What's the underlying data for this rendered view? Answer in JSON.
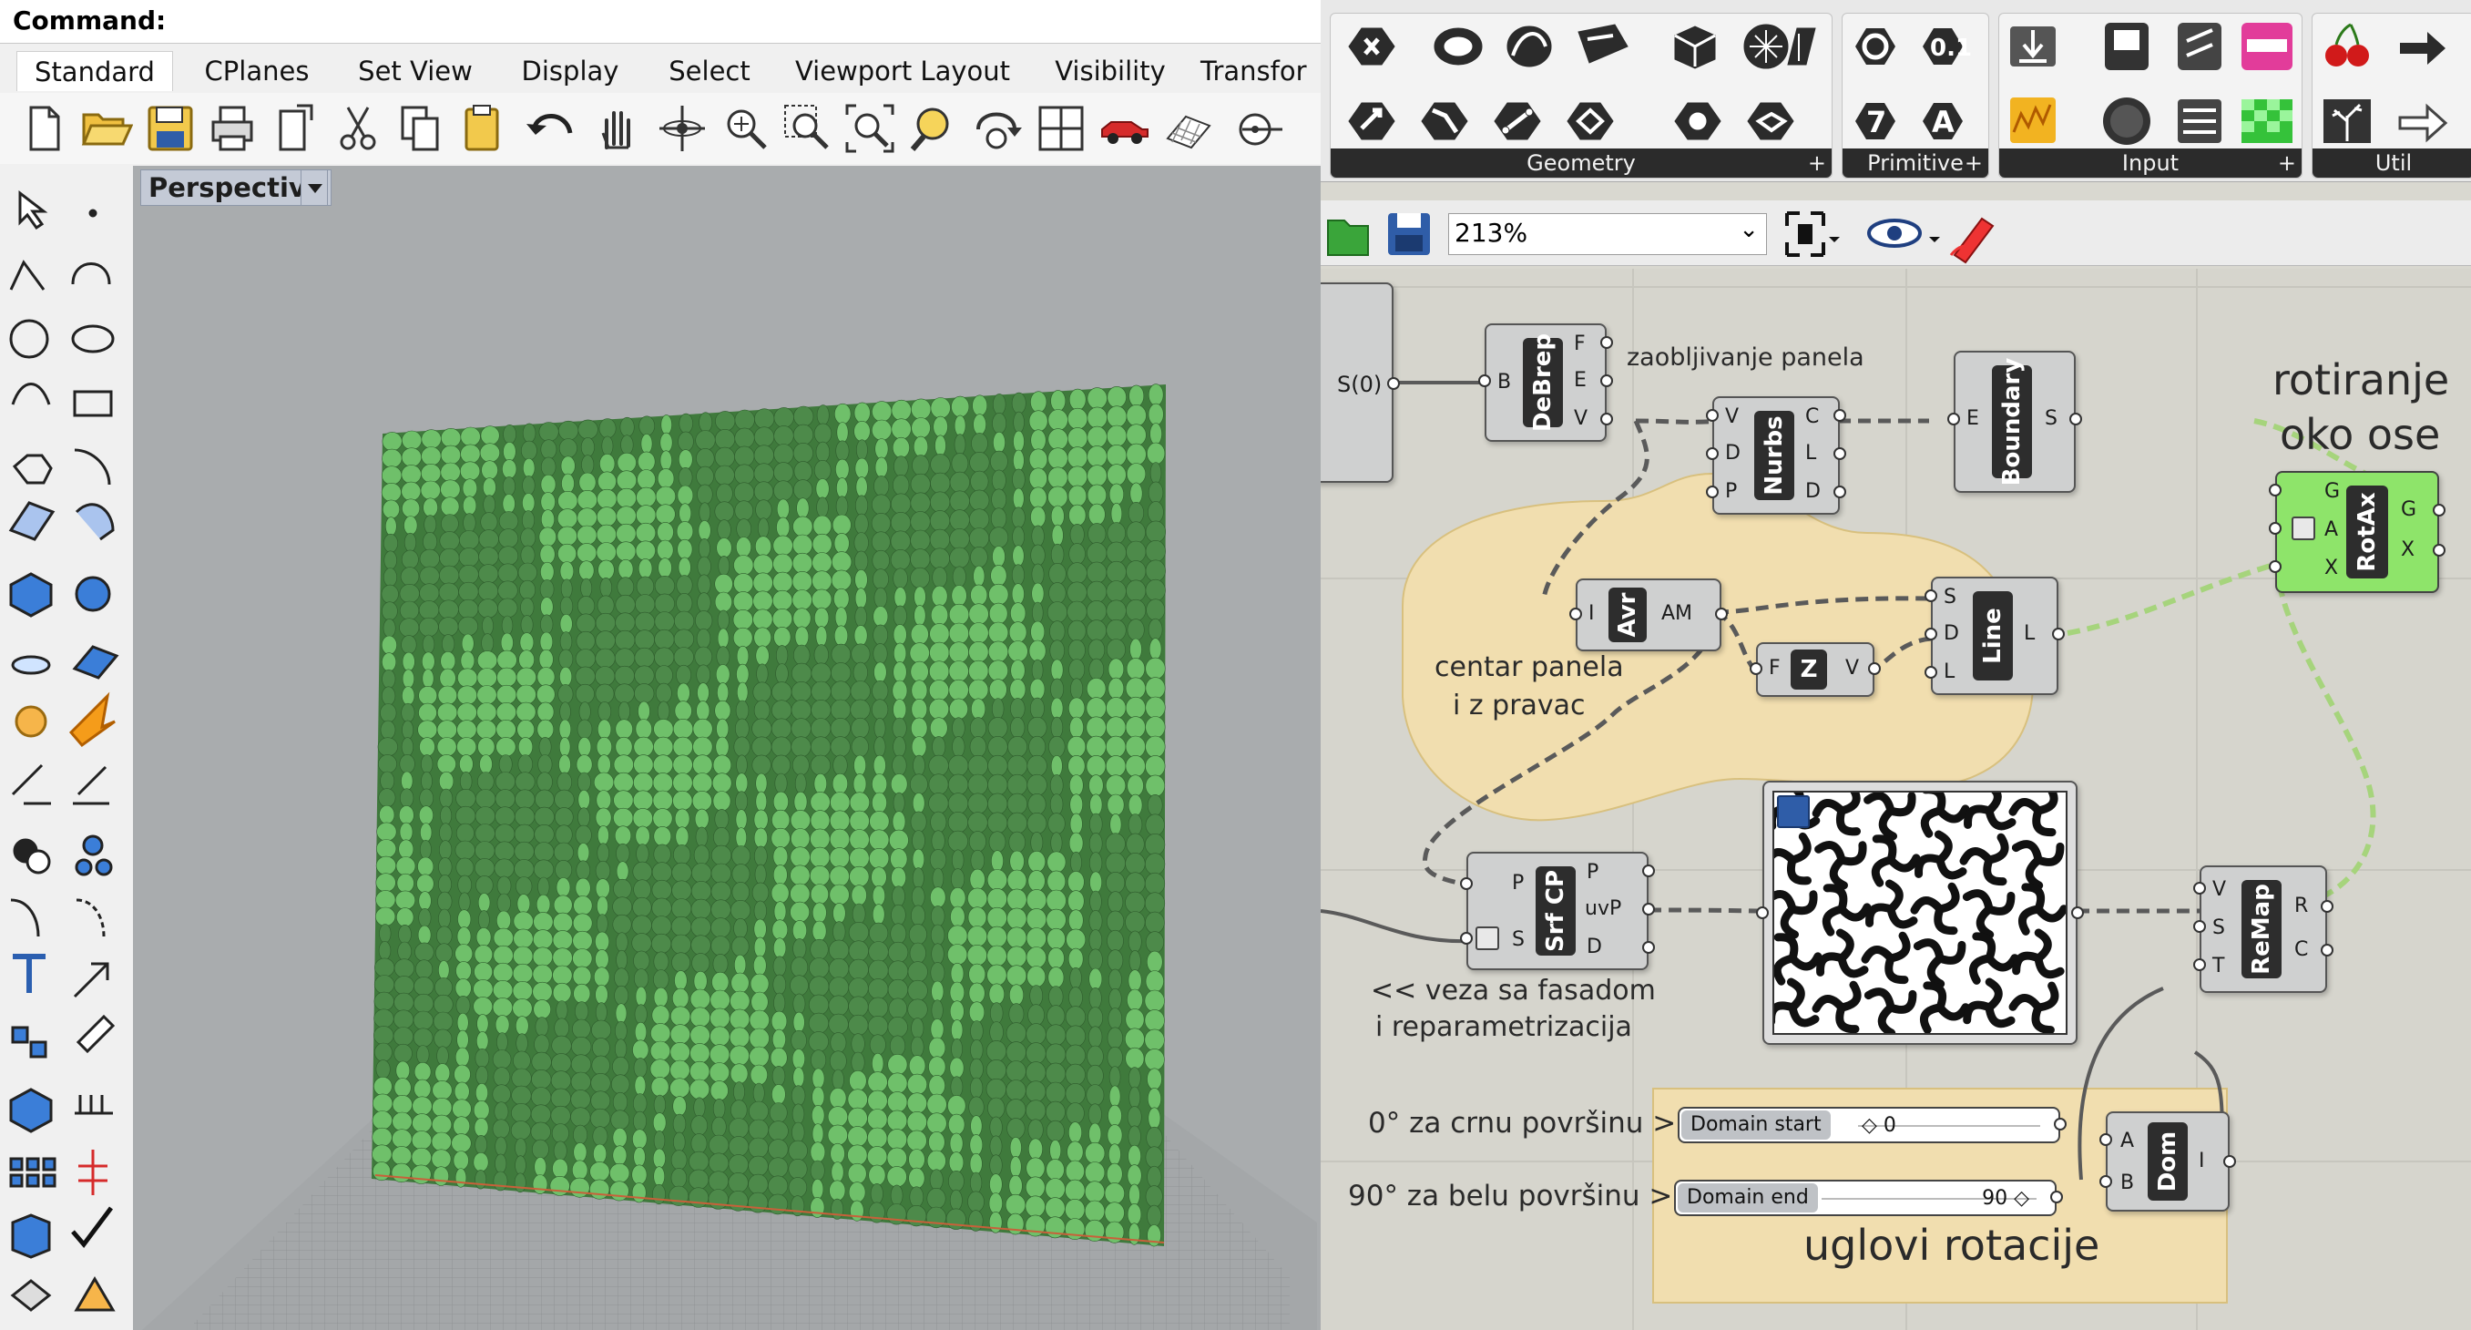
{
  "rhino": {
    "command_label": "Command:",
    "tabs": [
      "Standard",
      "CPlanes",
      "Set View",
      "Display",
      "Select",
      "Viewport Layout",
      "Visibility",
      "Transfor"
    ],
    "active_tab": "Standard",
    "toolbar_icons": [
      "new-icon",
      "open-icon",
      "save-icon",
      "print-icon",
      "import-icon",
      "cut-icon",
      "copy-icon",
      "paste-icon",
      "undo-icon",
      "pan-icon",
      "rotate-view-icon",
      "zoom-icon",
      "zoom-window-icon",
      "zoom-extents-icon",
      "zoom-selected-icon",
      "rotate-icon",
      "four-viewports-icon",
      "car-icon",
      "grid-icon",
      "point-icon"
    ],
    "left_tools": [
      "select-arrow-icon",
      "point-icon",
      "polyline-icon",
      "arc-icon",
      "circle-icon",
      "ellipse-icon",
      "curve-icon",
      "rectangle-icon",
      "polygon-icon",
      "fillet-icon",
      "surface-icon",
      "extrude-icon",
      "box-icon",
      "sphere-icon",
      "cylinder-icon",
      "mesh-icon",
      "gear-icon",
      "explode-icon",
      "trim-icon",
      "split-icon",
      "boolean-icon",
      "join-icon",
      "offset-icon",
      "blend-icon",
      "text-icon",
      "scale-icon",
      "array-icon",
      "edit-icon",
      "solid-box-icon",
      "dimension-icon",
      "grid-array-icon",
      "align-icon",
      "material-icon",
      "check-icon",
      "render-icon",
      "light-icon"
    ],
    "viewport_title": "Perspective",
    "colors": {
      "panel_light": "#6fc06a",
      "panel_dark": "#4d8a4a",
      "ground": "#8f9294"
    }
  },
  "grasshopper": {
    "ribbon_groups": [
      {
        "label": "Geometry",
        "icons": [
          "hexagon-icon",
          "ellipse-icon",
          "spiral-icon",
          "surface-icon",
          "cube-icon",
          "mesh-icon",
          "brep-icon",
          "vector-icon",
          "curve-icon",
          "line-icon",
          "plane-icon",
          "sphere-icon",
          "twisted-icon"
        ]
      },
      {
        "label": "Primitive",
        "icons": [
          "circle-icon",
          "binary-icon",
          "number-seven-icon",
          "letter-a-icon"
        ]
      },
      {
        "label": "Input",
        "icons": [
          "download-icon",
          "toggle-icon",
          "mobile-icon",
          "gradient-icon",
          "graph-mapper-icon",
          "button-icon",
          "value-list-icon",
          "image-icon"
        ]
      },
      {
        "label": "Util",
        "icons": [
          "cherry-icon",
          "arrow-right-icon",
          "tree-icon",
          "arrow-outline-icon"
        ]
      }
    ],
    "zoom": "213%",
    "toolbar_icons": [
      "open-folder-icon",
      "save-icon",
      "zoom-extents-icon",
      "preview-eye-icon",
      "sketch-icon"
    ],
    "components": [
      {
        "id": "s0",
        "name": "",
        "inputs": [],
        "outputs": [
          "S(0)"
        ]
      },
      {
        "id": "debrep",
        "name": "DeBrep",
        "inputs": [
          "B"
        ],
        "outputs": [
          "F",
          "E",
          "V"
        ]
      },
      {
        "id": "nurbs",
        "name": "Nurbs",
        "inputs": [
          "V",
          "D",
          "P"
        ],
        "outputs": [
          "C",
          "L",
          "D"
        ]
      },
      {
        "id": "boundary",
        "name": "Boundary",
        "inputs": [
          "E"
        ],
        "outputs": [
          "S"
        ]
      },
      {
        "id": "rotax",
        "name": "RotAx",
        "inputs": [
          "G",
          "A",
          "X"
        ],
        "outputs": [
          "G",
          "X"
        ]
      },
      {
        "id": "avr",
        "name": "Avr",
        "inputs": [
          "I"
        ],
        "outputs": [
          "AM"
        ]
      },
      {
        "id": "line",
        "name": "Line",
        "inputs": [
          "S",
          "D",
          "L"
        ],
        "outputs": [
          "L"
        ]
      },
      {
        "id": "zvec",
        "name": "Z",
        "inputs": [
          "F"
        ],
        "outputs": [
          "V"
        ]
      },
      {
        "id": "srfcp",
        "name": "Srf CP",
        "inputs": [
          "P",
          "S"
        ],
        "outputs": [
          "P",
          "uvP",
          "D"
        ]
      },
      {
        "id": "remap",
        "name": "ReMap",
        "inputs": [
          "V",
          "S",
          "T"
        ],
        "outputs": [
          "R",
          "C"
        ]
      },
      {
        "id": "dom",
        "name": "Dom",
        "inputs": [
          "A",
          "B"
        ],
        "outputs": [
          "I"
        ]
      }
    ],
    "notes": {
      "zaobljivanje": "zaobljivanje panela",
      "rotiranje1": "rotiranje",
      "rotiranje2": "oko ose",
      "centar1": "centar panela",
      "centar2": "i z pravac",
      "veza1": "<< veza sa fasadom",
      "veza2": "i reparametrizacija",
      "crna": "0° za crnu površinu >",
      "bela": "90° za belu površinu >",
      "uglovi": "uglovi rotacije"
    },
    "sliders": [
      {
        "label": "Domain start",
        "value": "◇ 0"
      },
      {
        "label": "Domain end",
        "value": "90 ◇"
      }
    ],
    "colors": {
      "canvas": "#d6d5cd",
      "group": "#f1deaf",
      "green_component": "#8ee46a",
      "wire": "#5a5a5a",
      "selected_wire": "#a6d47c"
    }
  }
}
